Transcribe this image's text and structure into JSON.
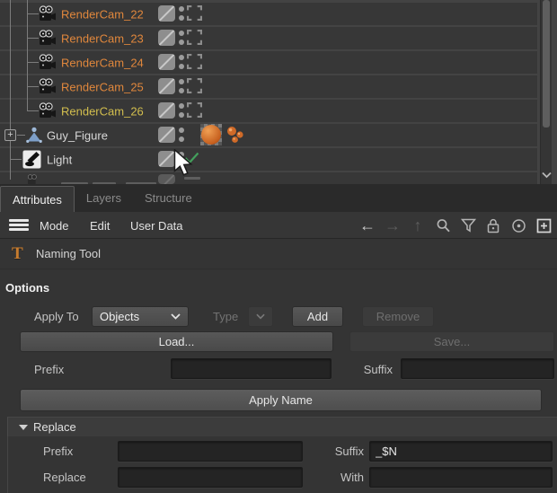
{
  "object_manager": {
    "rows": [
      {
        "label": "RenderCam_22",
        "type": "camera"
      },
      {
        "label": "RenderCam_23",
        "type": "camera"
      },
      {
        "label": "RenderCam_24",
        "type": "camera"
      },
      {
        "label": "RenderCam_25",
        "type": "camera"
      },
      {
        "label": "RenderCam_26",
        "type": "camera",
        "selected": true
      },
      {
        "label": "Guy_Figure",
        "type": "figure",
        "expandable": true,
        "has_materials": true
      },
      {
        "label": "Light",
        "type": "light",
        "enabled_check": true
      }
    ],
    "colors": {
      "camera_label": "#e0873c",
      "selected_label": "#d2be4e",
      "object_label": "#d8d8d8",
      "check_green": "#43a05c",
      "material_orange": "#c65f1e"
    }
  },
  "panel": {
    "tabs": [
      {
        "label": "Attributes",
        "active": true
      },
      {
        "label": "Layers",
        "active": false
      },
      {
        "label": "Structure",
        "active": false
      }
    ],
    "menu_items": [
      {
        "label": "Mode"
      },
      {
        "label": "Edit"
      },
      {
        "label": "User Data"
      }
    ],
    "toolbar_icons": [
      "back-arrow",
      "forward-arrow",
      "up-arrow",
      "search",
      "filter",
      "lock",
      "target",
      "new-panel"
    ],
    "tool_header": {
      "icon_glyph": "T",
      "title": "Naming Tool"
    },
    "options": {
      "heading": "Options",
      "apply_to": {
        "label": "Apply To",
        "value": "Objects"
      },
      "type": {
        "label": "Type",
        "value": ""
      },
      "add_label": "Add",
      "remove_label": "Remove",
      "load_label": "Load...",
      "save_label": "Save...",
      "prefix": {
        "label": "Prefix",
        "value": ""
      },
      "suffix": {
        "label": "Suffix",
        "value": ""
      },
      "apply_name_label": "Apply Name"
    },
    "replace": {
      "title": "Replace",
      "prefix": {
        "label": "Prefix",
        "value": ""
      },
      "suffix": {
        "label": "Suffix",
        "value": "_$N"
      },
      "replace": {
        "label": "Replace",
        "value": ""
      },
      "with": {
        "label": "With",
        "value": ""
      }
    }
  }
}
